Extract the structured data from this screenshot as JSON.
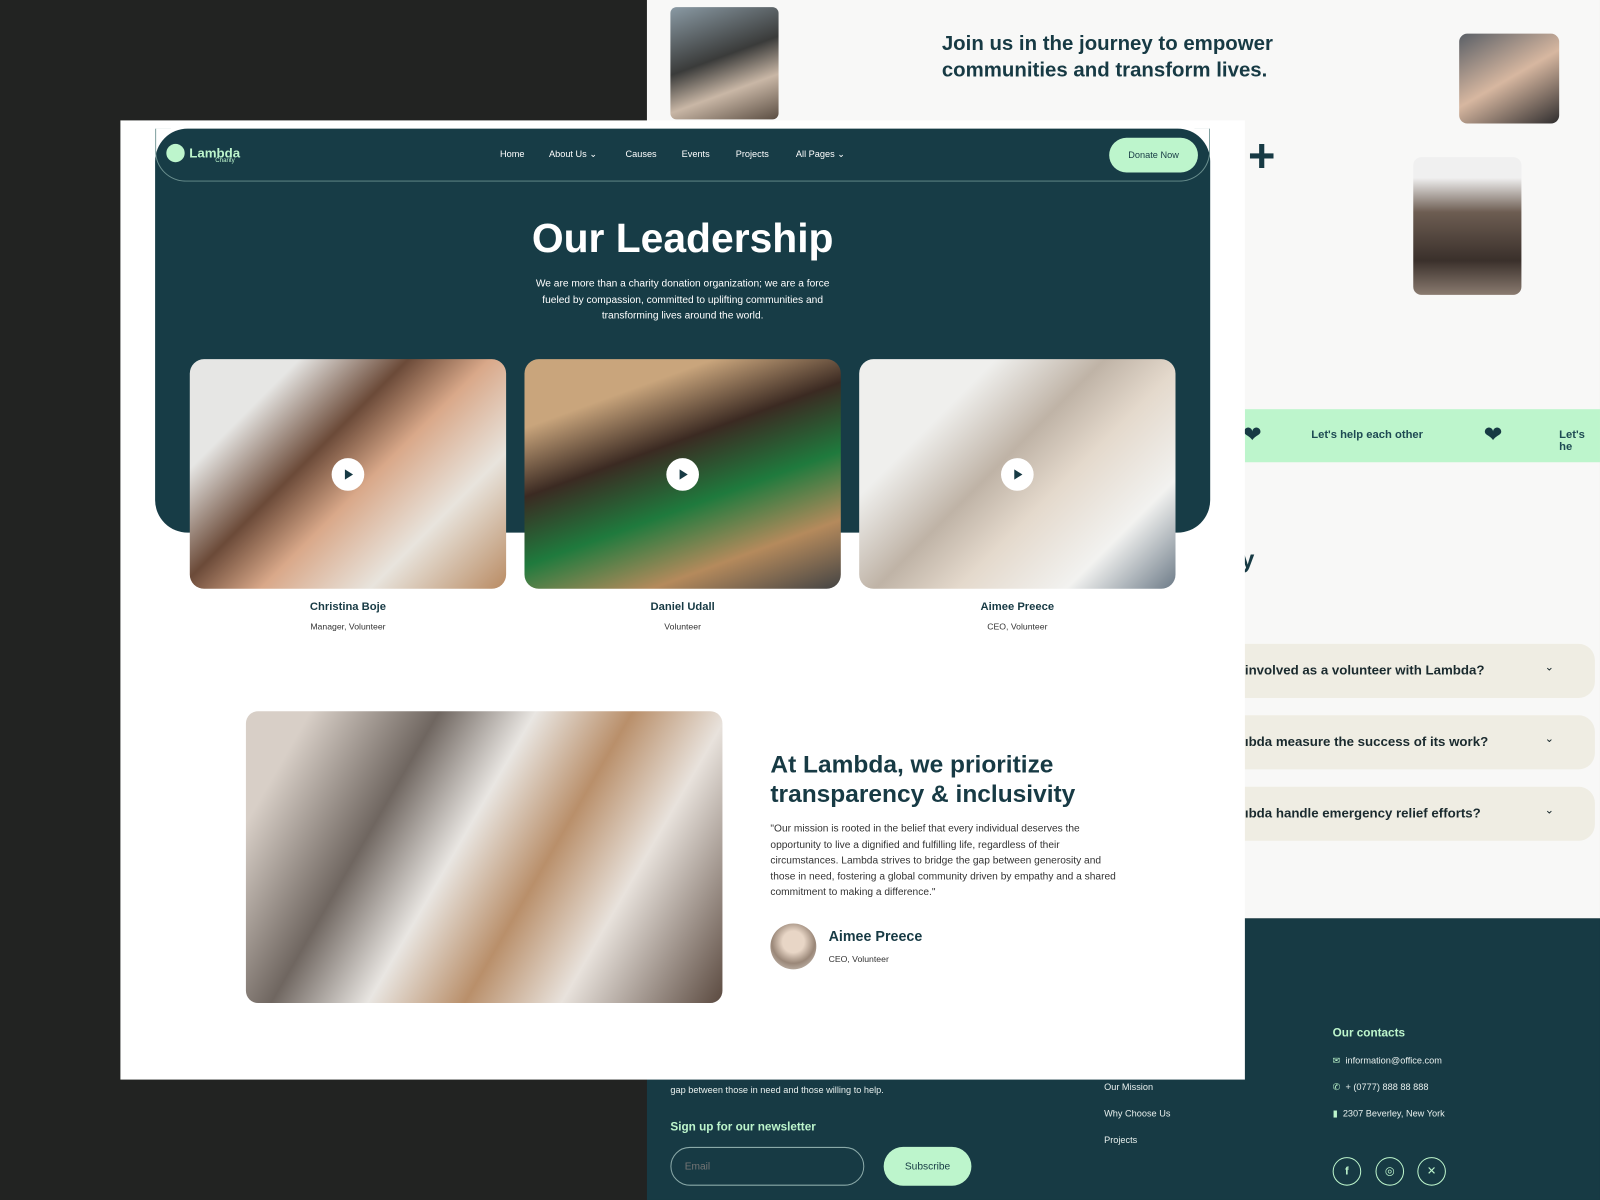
{
  "background_page": {
    "join_heading": "Join us in the journey to empower communities and transform lives.",
    "strip": {
      "text": "Let's help each other",
      "text_cut": "Let's he",
      "icon": "heart-box-icon"
    },
    "cut_heading_fragment": "y",
    "faq": [
      "involved as a volunteer with Lambda?",
      "ıbda measure the success of its work?",
      "ıbda handle emergency relief efforts?"
    ],
    "footer": {
      "about_text": "gap between those in need and those willing to help.",
      "newsletter_title": "Sign up for our newsletter",
      "email_placeholder": "Email",
      "subscribe_label": "Subscribe",
      "links": [
        "Our Mission",
        "Why Choose Us",
        "Projects"
      ],
      "contacts_title": "Our contacts",
      "email": "information@office.com",
      "phone": "+ (0777) 888 88 888",
      "address": "2307 Beverley, New York",
      "social": [
        "facebook",
        "instagram",
        "x"
      ]
    }
  },
  "header": {
    "logo": "Lambda",
    "logo_sub": "Charity",
    "nav": [
      "Home",
      "About Us",
      "Causes",
      "Events",
      "Projects",
      "All Pages"
    ],
    "donate_label": "Donate Now"
  },
  "hero": {
    "title": "Our Leadership",
    "subtitle": "We are more than a charity donation organization; we are a force fueled by compassion, committed to uplifting communities and transforming lives around the world."
  },
  "team": [
    {
      "name": "Christina Boje",
      "role": "Manager, Volunteer"
    },
    {
      "name": "Daniel Udall",
      "role": "Volunteer"
    },
    {
      "name": "Aimee Preece",
      "role": "CEO, Volunteer"
    }
  ],
  "mission": {
    "heading": "At Lambda, we prioritize transparency & inclusivity",
    "quote": "\"Our mission is rooted in the belief that every individual deserves the opportunity to live a dignified and fulfilling life, regardless of their circumstances. Lambda strives to bridge the gap between generosity and those in need, fostering a global community driven by empathy and a shared commitment to making a difference.\"",
    "author": "Aimee Preece",
    "author_role": "CEO, Volunteer"
  },
  "colors": {
    "primary": "#173c46",
    "accent": "#bdf5cc",
    "faq_bg": "#efede3"
  }
}
